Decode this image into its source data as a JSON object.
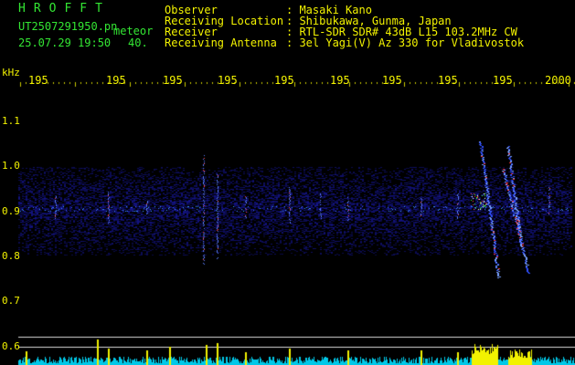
{
  "header": {
    "app_name": "HROFFT",
    "filename": "UT2507291950.pn",
    "mode": "meteor",
    "datetime": "25.07.29 19:50",
    "count": "40.",
    "labels": {
      "observer": "Observer",
      "location": "Receiving Location",
      "receiver": "Receiver",
      "antenna": "Receiving Antenna"
    },
    "values": {
      "observer": ": Masaki Kano",
      "location": ": Shibukawa, Gunma, Japan",
      "receiver": ": RTL-SDR SDR# 43dB L15 103.2MHz CW",
      "antenna": ": 3el Yagi(V) Az 330 for Vladivostok"
    }
  },
  "axis": {
    "y_unit": "kHz",
    "y_ticks": [
      "1.1",
      "1.0",
      "0.9",
      "0.8",
      "0.7",
      "0.6"
    ],
    "x_ticks": [
      "195",
      "195",
      "195",
      "195",
      "195",
      "195",
      "195",
      "195",
      "195",
      "2000"
    ]
  },
  "colors": {
    "background": "#000000",
    "label_text": "#f2f200",
    "app_title": "#33e633",
    "noise_band": "#0a0a70",
    "meteor_trail": "#3a5cff",
    "level_bar": "#00c8e8",
    "level_peak": "#f2f200"
  }
}
